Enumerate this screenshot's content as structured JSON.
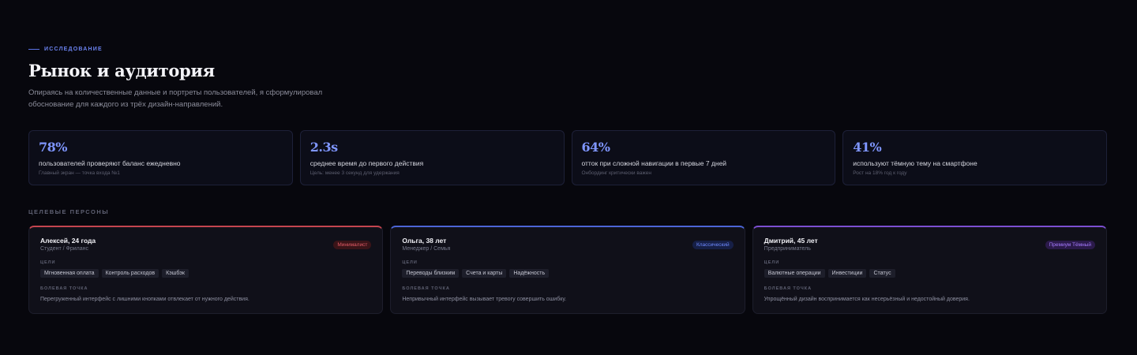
{
  "header": {
    "eyebrow": "ИССЛЕДОВАНИЕ",
    "title": "Рынок и аудитория",
    "intro": "Опираясь на количественные данные и портреты пользователей, я сформулировал обоснование для каждого из трёх дизайн-направлений."
  },
  "stats": [
    {
      "value": "78%",
      "label": "пользователей проверяют баланс ежедневно",
      "note": "Главный экран — точка входа №1"
    },
    {
      "value": "2.3s",
      "label": "среднее время до первого действия",
      "note": "Цель: менее 3 секунд для удержания"
    },
    {
      "value": "64%",
      "label": "отток при сложной навигации в первые 7 дней",
      "note": "Онбординг критически важен"
    },
    {
      "value": "41%",
      "label": "используют тёмную тему на смартфоне",
      "note": "Рост на 18% год к году"
    }
  ],
  "personas_section": {
    "label": "ЦЕЛЕВЫЕ ПЕРСОНЫ"
  },
  "personas": [
    {
      "name": "Алексей, 24 года",
      "role": "Студент / Фриланс",
      "tag": "Минималист",
      "goals_label": "ЦЕЛИ",
      "goals": [
        "Мгновенная оплата",
        "Контроль расходов",
        "Кэшбэк"
      ],
      "pain_label": "БОЛЕВАЯ ТОЧКА",
      "pain": "Перегруженный интерфейс с лишними кнопками отвлекает от нужного действия.",
      "accent": "#c4454f"
    },
    {
      "name": "Ольга, 38 лет",
      "role": "Менеджер / Семья",
      "tag": "Классический",
      "goals_label": "ЦЕЛИ",
      "goals": [
        "Переводы близким",
        "Счета и карты",
        "Надёжность"
      ],
      "pain_label": "БОЛЕВАЯ ТОЧКА",
      "pain": "Непривычный интерфейс вызывает тревогу совершить ошибку.",
      "accent": "#4c65d6"
    },
    {
      "name": "Дмитрий, 45 лет",
      "role": "Предприниматель",
      "tag": "Премиум Тёмный",
      "goals_label": "ЦЕЛИ",
      "goals": [
        "Валютные операции",
        "Инвестиции",
        "Статус"
      ],
      "pain_label": "БОЛЕВАЯ ТОЧКА",
      "pain": "Упрощённый дизайн воспринимается как несерьёзный и недостойный доверия.",
      "accent": "#7c4fd1"
    }
  ]
}
